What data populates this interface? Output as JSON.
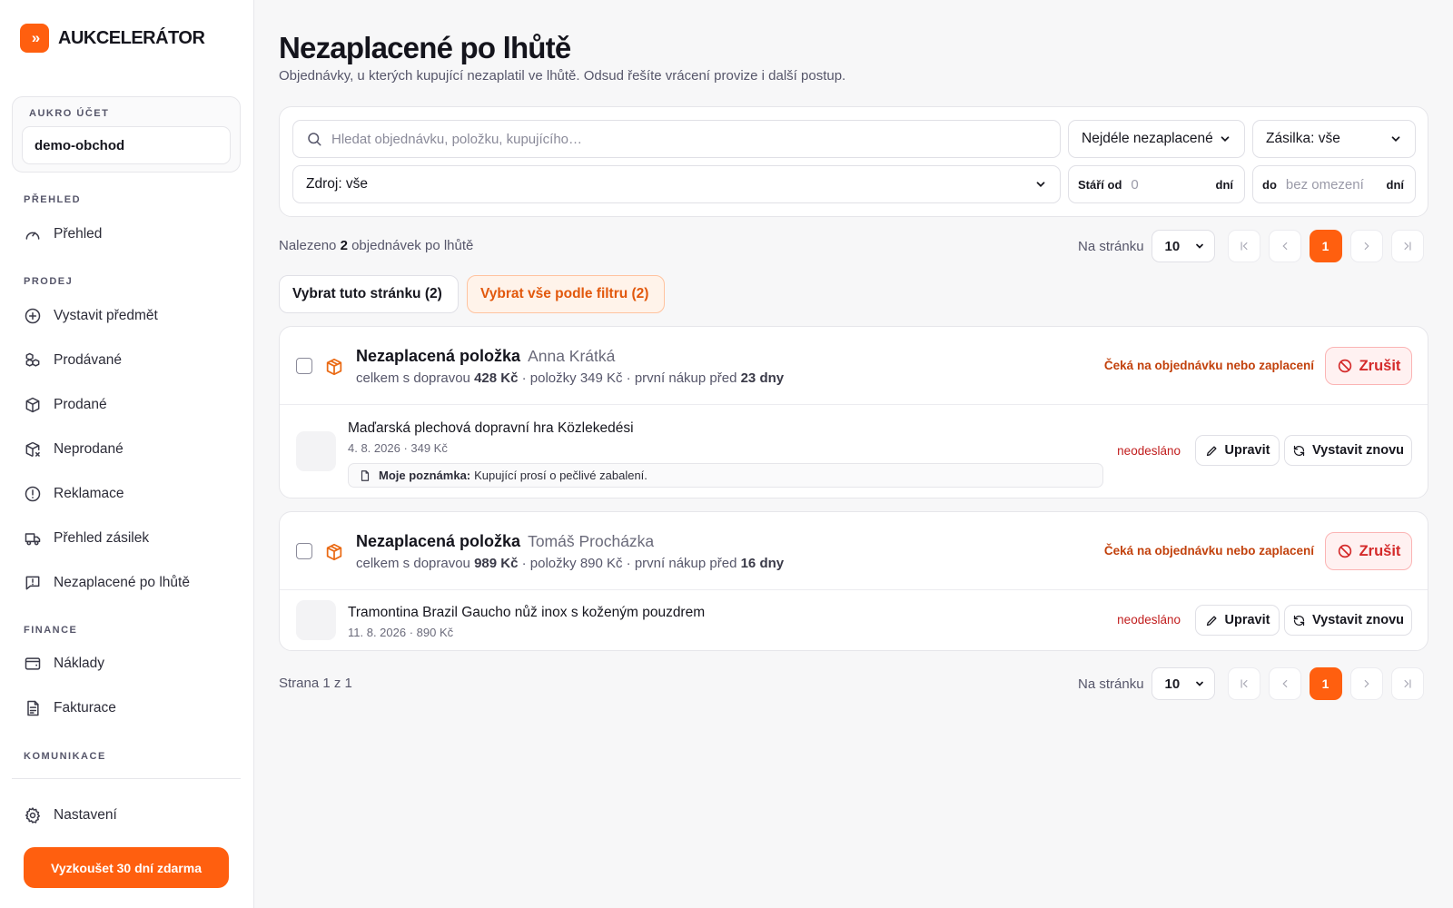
{
  "app": {
    "logo_glyph": "»",
    "name": "AUKCELERÁTOR",
    "accent_color": "#ff5f0f"
  },
  "account": {
    "label": "AUKRO ÚČET",
    "value": "demo-obchod"
  },
  "sidebar": {
    "sections": [
      {
        "label": "PŘEHLED"
      },
      {
        "label": "PRODEJ"
      },
      {
        "label": "FINANCE"
      },
      {
        "label": "KOMUNIKACE"
      }
    ],
    "items": [
      {
        "label": "Přehled",
        "icon": "gauge-icon"
      },
      {
        "label": "Vystavit předmět",
        "icon": "plus-circle-icon"
      },
      {
        "label": "Prodávané",
        "icon": "boxes-icon"
      },
      {
        "label": "Prodané",
        "icon": "package-check-icon"
      },
      {
        "label": "Neprodané",
        "icon": "package-x-icon"
      },
      {
        "label": "Reklamace",
        "icon": "alert-circle-icon"
      },
      {
        "label": "Přehled zásilek",
        "icon": "truck-icon"
      },
      {
        "label": "Nezaplacené po lhůtě",
        "icon": "message-alert-icon"
      },
      {
        "label": "Náklady",
        "icon": "wallet-icon"
      },
      {
        "label": "Fakturace",
        "icon": "invoice-icon"
      }
    ],
    "settings": {
      "label": "Nastavení",
      "icon": "gear-icon"
    },
    "trial_button": "Vyzkoušet 30 dní zdarma"
  },
  "page": {
    "title": "Nezaplacené po lhůtě",
    "subtitle": "Objednávky, u kterých kupující nezaplatil ve lhůtě. Odsud řešíte vrácení provize i další postup."
  },
  "filters": {
    "search_placeholder": "Hledat objednávku, položku, kupujícího…",
    "sort": "Nejdéle nezaplacené",
    "shipment": "Zásilka: vše",
    "source": "Zdroj: vše",
    "age_from_label": "Stáří od",
    "age_from_placeholder": "0",
    "age_to_label": "do",
    "age_to_placeholder": "bez omezení",
    "unit": "dní"
  },
  "results": {
    "prefix": "Nalezeno",
    "count": "2",
    "suffix": "objednávek po lhůtě"
  },
  "pagination": {
    "per_page_label": "Na stránku",
    "per_page_value": "10",
    "current_page": "1",
    "page_summary": "Strana 1 z 1"
  },
  "bulk": {
    "select_page": "Vybrat tuto stránku (2)",
    "select_filter": "Vybrat vše podle filtru (2)"
  },
  "orders": [
    {
      "title": "Nezaplacená položka",
      "buyer": "Anna Krátká",
      "meta_prefix": "celkem s dopravou",
      "total": "428 Kč",
      "meta_mid": "· položky 349 Kč · první nákup před",
      "age": "23 dny",
      "status": "Čeká na objednávku nebo zaplacení",
      "cancel": "Zrušit",
      "item": {
        "name": "Maďarská plechová dopravní hra Közlekedési",
        "sub": "4. 8. 2026 · 349 Kč",
        "note_label": "Moje poznámka:",
        "note_text": "Kupující prosí o pečlivé zabalení.",
        "status": "neodesláno",
        "edit": "Upravit",
        "relist": "Vystavit znovu"
      }
    },
    {
      "title": "Nezaplacená položka",
      "buyer": "Tomáš Procházka",
      "meta_prefix": "celkem s dopravou",
      "total": "989 Kč",
      "meta_mid": "· položky 890 Kč · první nákup před",
      "age": "16 dny",
      "status": "Čeká na objednávku nebo zaplacení",
      "cancel": "Zrušit",
      "item": {
        "name": "Tramontina Brazil Gaucho nůž inox s koženým pouzdrem",
        "sub": "11. 8. 2026 · 890 Kč",
        "status": "neodesláno",
        "edit": "Upravit",
        "relist": "Vystavit znovu"
      }
    }
  ]
}
